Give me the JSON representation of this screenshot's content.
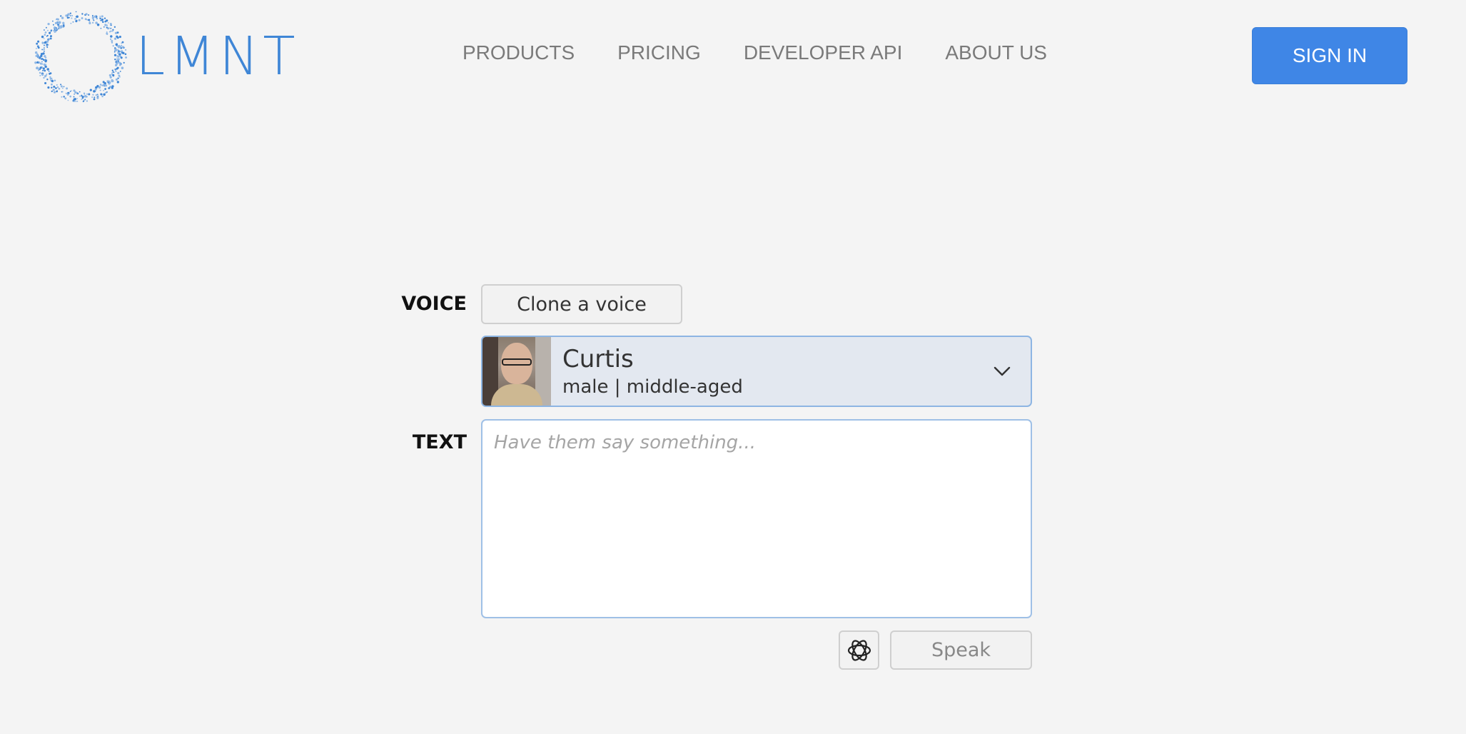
{
  "brand": {
    "name": "LMNT",
    "accent": "#3f86e6"
  },
  "nav": {
    "items": [
      {
        "label": "PRODUCTS"
      },
      {
        "label": "PRICING"
      },
      {
        "label": "DEVELOPER API"
      },
      {
        "label": "ABOUT US"
      }
    ],
    "signin_label": "SIGN IN"
  },
  "form": {
    "voice_label": "VOICE",
    "clone_label": "Clone a voice",
    "selected_voice": {
      "name": "Curtis",
      "meta": "male | middle-aged"
    },
    "text_label": "TEXT",
    "text_placeholder": "Have them say something...",
    "text_value": "",
    "speak_label": "Speak",
    "gpt_icon": "openai-icon"
  }
}
